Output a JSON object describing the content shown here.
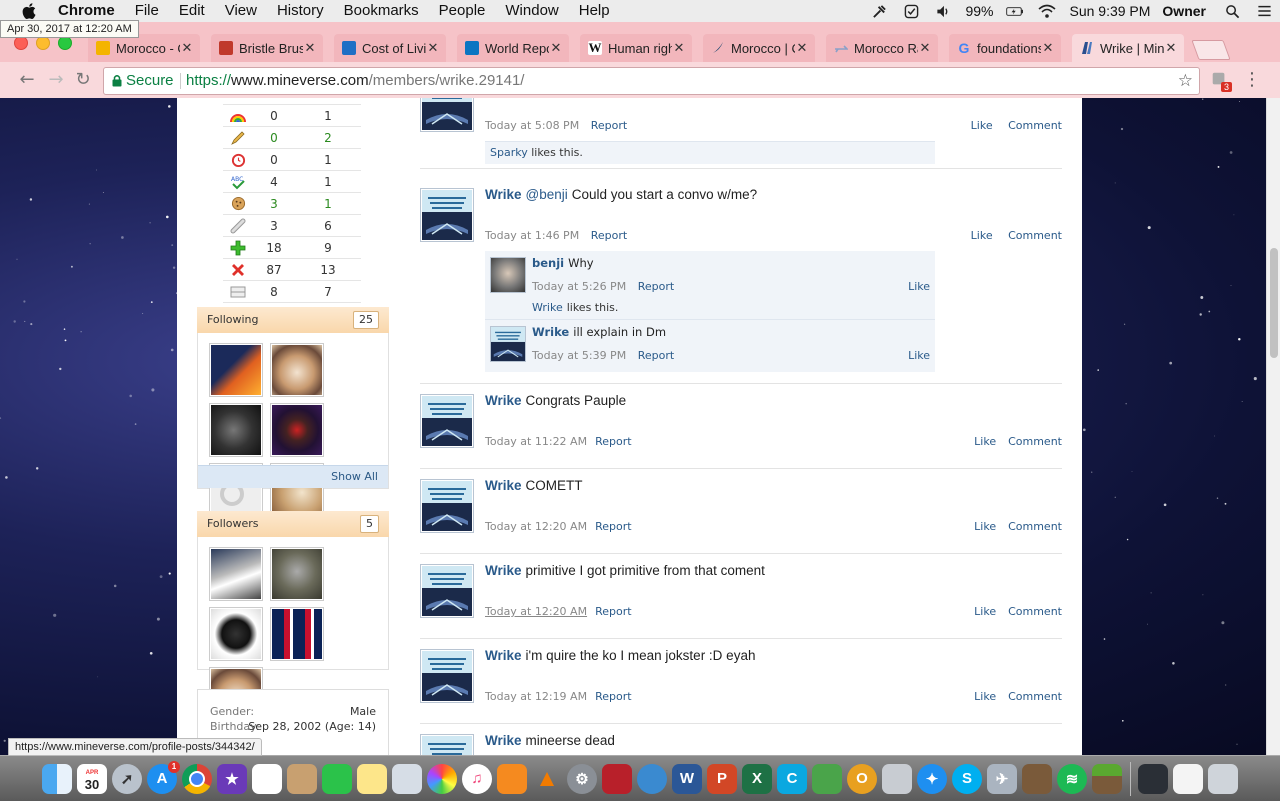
{
  "menubar": {
    "app": "Chrome",
    "items": [
      "File",
      "Edit",
      "View",
      "History",
      "Bookmarks",
      "People",
      "Window",
      "Help"
    ],
    "battery": "99%",
    "clock": "Sun 9:39 PM",
    "user": "Owner"
  },
  "tooltip_date": "Apr 30, 2017 at 12:20 AM",
  "tabs": [
    {
      "title": "Morocco - G",
      "fav_color": "#f4b400"
    },
    {
      "title": "Bristle Brush",
      "fav_color": "#c0392b"
    },
    {
      "title": "Cost of Livin",
      "fav_color": "#1f6fc5"
    },
    {
      "title": "World Repo",
      "fav_color": "#0a75c2"
    },
    {
      "title": "Human right",
      "fav_color": "#ffffff"
    },
    {
      "title": "Morocco | C",
      "fav_color": "#12416b"
    },
    {
      "title": "Morocco Ra",
      "fav_color": "#8aa0c8"
    },
    {
      "title": "foundations",
      "fav_color": "#ffffff"
    },
    {
      "title": "Wrike | Mine",
      "fav_color": "#2a4f8f"
    }
  ],
  "address": {
    "secure_label": "Secure",
    "scheme": "https://",
    "host": "www.mineverse.com",
    "path": "/members/wrike.29141/"
  },
  "extension_badge": "3",
  "stats": [
    {
      "icon": "rainbow-icon",
      "a": "0",
      "b": "1",
      "green": false
    },
    {
      "icon": "pencil-icon",
      "a": "0",
      "b": "2",
      "green": true
    },
    {
      "icon": "clock-icon",
      "a": "0",
      "b": "1",
      "green": false
    },
    {
      "icon": "abc-check-icon",
      "a": "4",
      "b": "1",
      "green": false
    },
    {
      "icon": "cookie-icon",
      "a": "3",
      "b": "1",
      "green": true
    },
    {
      "icon": "bandage-icon",
      "a": "3",
      "b": "6",
      "green": false
    },
    {
      "icon": "plus-icon",
      "a": "18",
      "b": "9",
      "green": false
    },
    {
      "icon": "x-icon",
      "a": "87",
      "b": "13",
      "green": false
    },
    {
      "icon": "bars-icon",
      "a": "8",
      "b": "7",
      "green": false
    }
  ],
  "following": {
    "label": "Following",
    "count": "25",
    "show_all": "Show All"
  },
  "followers": {
    "label": "Followers",
    "count": "5"
  },
  "info": {
    "gender_label": "Gender:",
    "gender": "Male",
    "birthday_label": "Birthday:",
    "birthday": "Sep 28, 2002 (Age: 14)"
  },
  "posts": [
    {
      "author": "",
      "mention": "",
      "text": "",
      "time": "Today at 5:08 PM",
      "report": "Report",
      "like": "Like",
      "comment": "Comment",
      "likes_by": "Sparky",
      "likes_text": "likes this."
    },
    {
      "author": "Wrike",
      "mention": "@benji",
      "text": "Could you start a convo w/me?",
      "time": "Today at 1:46 PM",
      "report": "Report",
      "like": "Like",
      "comment": "Comment"
    },
    {
      "author": "Wrike",
      "text": "Congrats Pauple",
      "time": "Today at 11:22 AM",
      "report": "Report",
      "like": "Like",
      "comment": "Comment"
    },
    {
      "author": "Wrike",
      "text": "COMETT",
      "time": "Today at 12:20 AM",
      "report": "Report",
      "like": "Like",
      "comment": "Comment"
    },
    {
      "author": "Wrike",
      "text": "primitive I got primitive from that coment",
      "time": "Today at 12:20 AM",
      "report": "Report",
      "like": "Like",
      "comment": "Comment"
    },
    {
      "author": "Wrike",
      "text": "i'm quire the ko I mean jokster :D eyah",
      "time": "Today at 12:19 AM",
      "report": "Report",
      "like": "Like",
      "comment": "Comment"
    },
    {
      "author": "Wrike",
      "text": "mineerse dead"
    }
  ],
  "comments": [
    {
      "author": "benji",
      "text": "Why",
      "time": "Today at 5:26 PM",
      "report": "Report",
      "like": "Like",
      "likes_by": "Wrike",
      "likes_text": "likes this."
    },
    {
      "author": "Wrike",
      "text": "ill explain in Dm",
      "time": "Today at 5:39 PM",
      "report": "Report",
      "like": "Like"
    }
  ],
  "status_url": "https://www.mineverse.com/profile-posts/344342/",
  "dock": {
    "calendar_month": "APR",
    "calendar_day": "30",
    "appstore_badge": "1"
  }
}
